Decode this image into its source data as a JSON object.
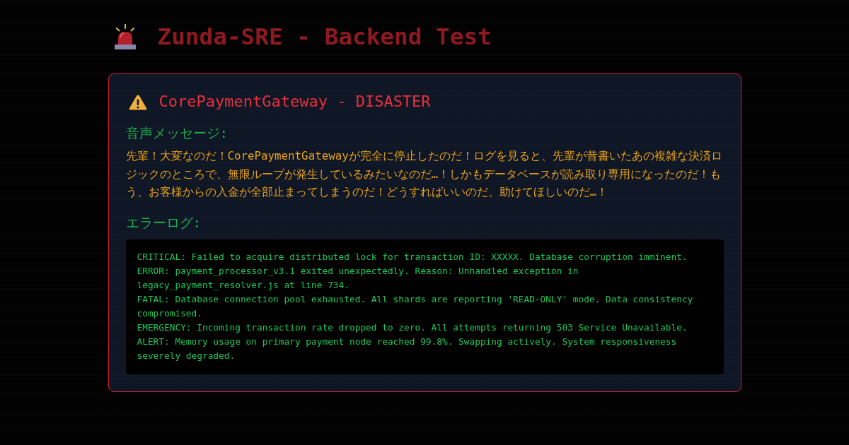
{
  "header": {
    "title": "Zunda-SRE - Backend Test"
  },
  "alert": {
    "title": "CorePaymentGateway - DISASTER",
    "voice_message": {
      "heading": "音声メッセージ:",
      "text": "先輩！大変なのだ！CorePaymentGatewayが完全に停止したのだ！ログを見ると、先輩が昔書いたあの複雑な決済ロジックのところで、無限ループが発生しているみたいなのだ…！しかもデータベースが読み取り専用になったのだ！もう、お客様からの入金が全部止まってしまうのだ！どうすればいいのだ、助けてほしいのだ…！"
    },
    "error_log": {
      "heading": "エラーログ:",
      "lines": [
        "CRITICAL: Failed to acquire distributed lock for transaction ID: XXXXX. Database corruption imminent.",
        "ERROR: payment_processor_v3.1 exited unexpectedly. Reason: Unhandled exception in legacy_payment_resolver.js at line 734.",
        "FATAL: Database connection pool exhausted. All shards are reporting 'READ-ONLY' mode. Data consistency compromised.",
        "EMERGENCY: Incoming transaction rate dropped to zero. All attempts returning 503 Service Unavailable.",
        "ALERT: Memory usage on primary payment node reached 99.8%. Swapping actively. System responsiveness severely degraded."
      ]
    }
  }
}
